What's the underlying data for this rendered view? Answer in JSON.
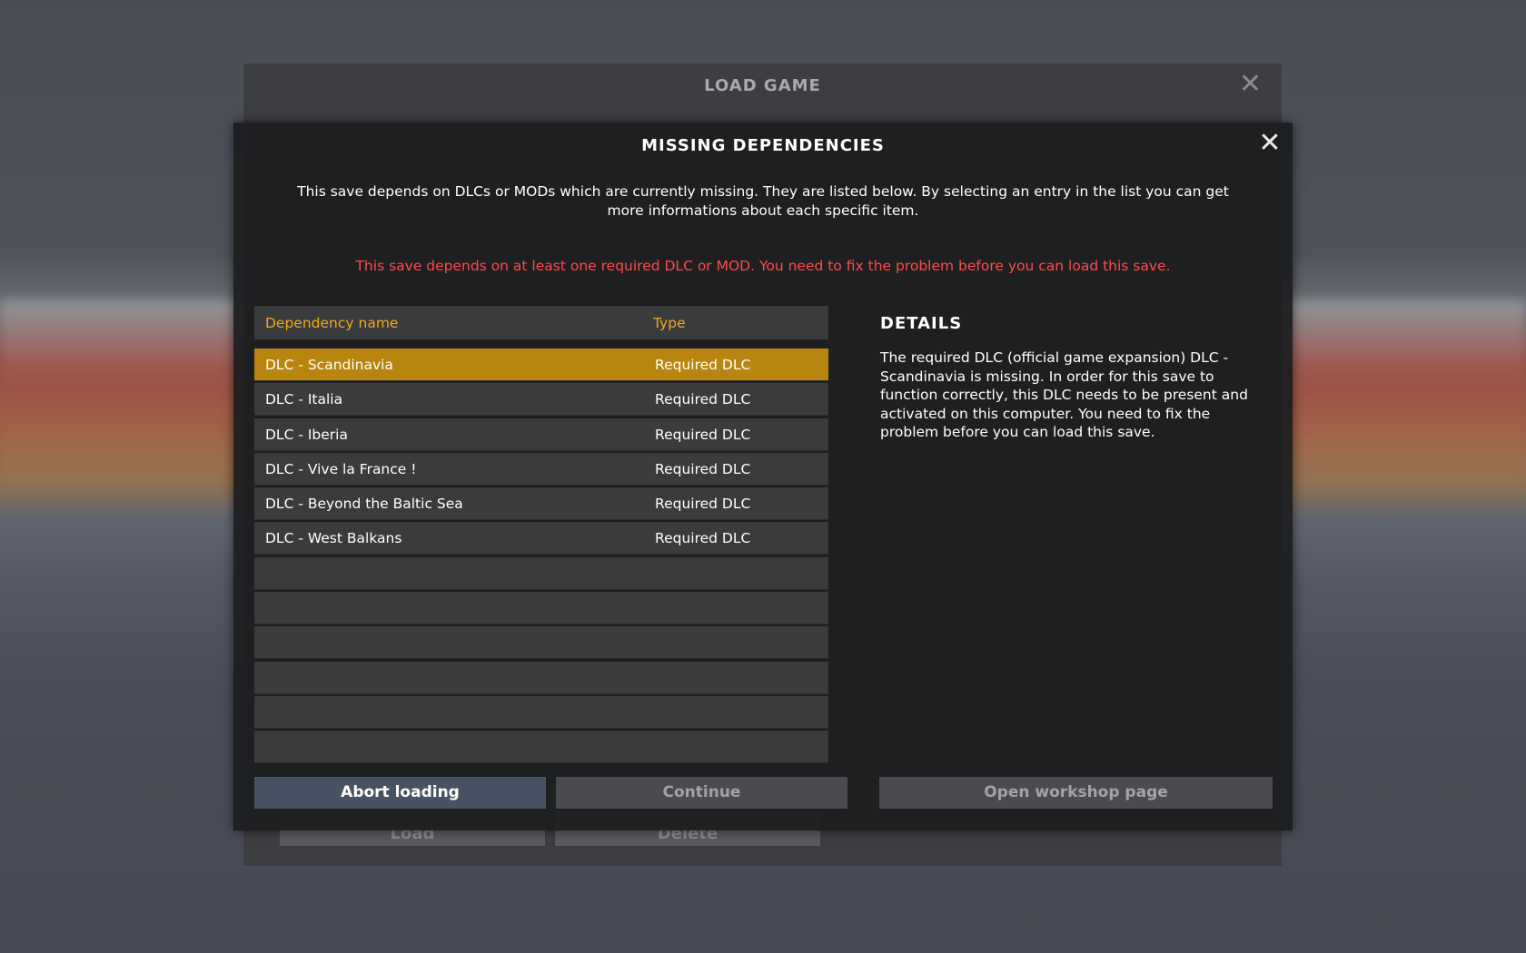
{
  "background_window": {
    "title": "LOAD GAME",
    "close_icon": "close-icon",
    "buttons": {
      "load": "Load",
      "delete": "Delete"
    }
  },
  "modal": {
    "title": "MISSING DEPENDENCIES",
    "close_icon": "close-icon",
    "description": "This save depends on DLCs or MODs which are currently missing. They are listed below. By selecting an entry in the list you can get more informations about each specific item.",
    "warning": "This save depends on at least one required DLC or MOD. You need to fix the problem before you can load this save.",
    "table": {
      "columns": {
        "name": "Dependency name",
        "type": "Type"
      },
      "rows": [
        {
          "name": "DLC - Scandinavia",
          "type": "Required DLC",
          "selected": true
        },
        {
          "name": "DLC - Italia",
          "type": "Required DLC"
        },
        {
          "name": "DLC - Iberia",
          "type": "Required DLC"
        },
        {
          "name": "DLC - Vive la France !",
          "type": "Required DLC"
        },
        {
          "name": "DLC - Beyond the Baltic Sea",
          "type": "Required DLC"
        },
        {
          "name": "DLC - West Balkans",
          "type": "Required DLC"
        }
      ],
      "empty_rows": 6
    },
    "details": {
      "title": "DETAILS",
      "text": "The required DLC (official game expansion) DLC - Scandinavia is missing. In order for this save to function correctly, this DLC needs to be present and activated on this computer. You need to fix the problem before you can load this save."
    },
    "buttons": {
      "abort": "Abort loading",
      "continue": "Continue",
      "workshop": "Open workshop page"
    }
  },
  "colors": {
    "accent": "#f2a81e",
    "selected_row": "#b8860f",
    "warning": "#ff4b4b",
    "primary_button": "#475363"
  }
}
